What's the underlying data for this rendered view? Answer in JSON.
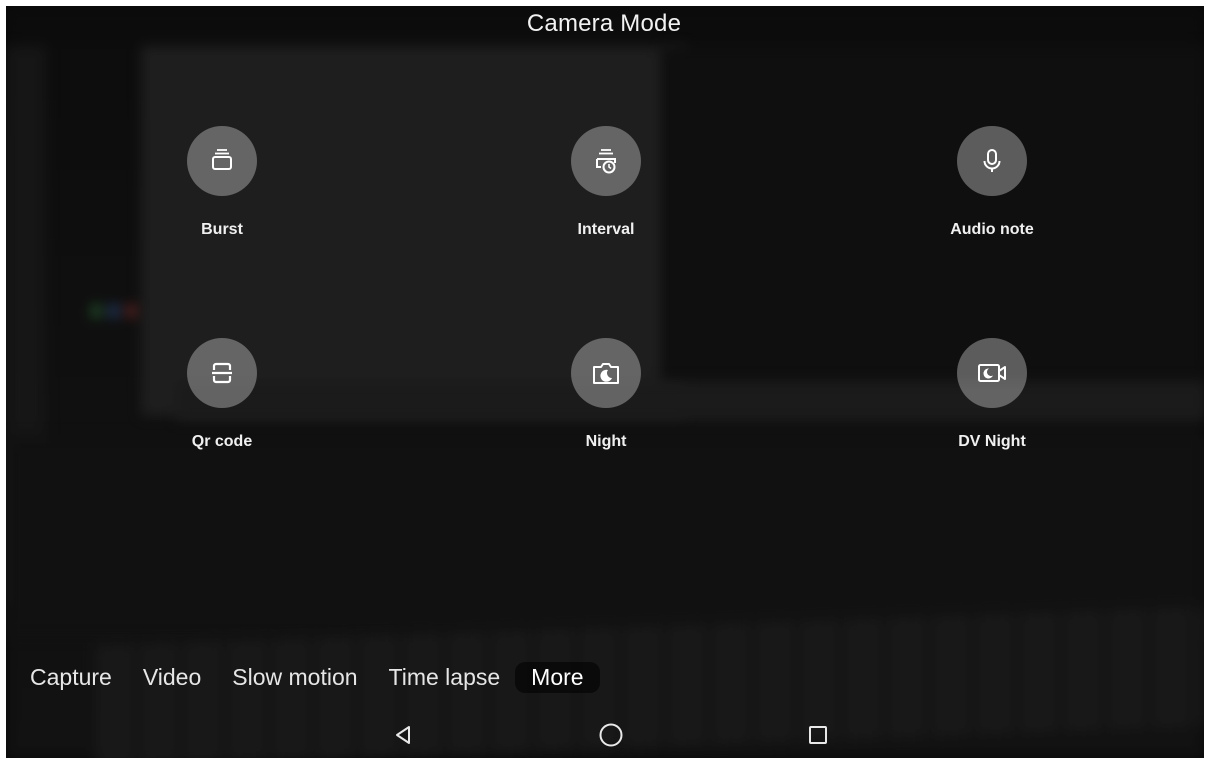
{
  "header": {
    "title": "Camera Mode"
  },
  "modes": [
    {
      "label": "Burst",
      "icon": "burst-icon"
    },
    {
      "label": "Interval",
      "icon": "interval-icon"
    },
    {
      "label": "Audio note",
      "icon": "microphone-icon"
    },
    {
      "label": "Qr code",
      "icon": "qr-code-icon"
    },
    {
      "label": "Night",
      "icon": "night-camera-icon"
    },
    {
      "label": "DV Night",
      "icon": "night-video-icon"
    }
  ],
  "mode_bar": {
    "tabs": [
      "Capture",
      "Video",
      "Slow motion",
      "Time lapse",
      "More"
    ],
    "active": "More"
  },
  "nav_bar": {
    "buttons": [
      "back-icon",
      "home-icon",
      "recents-icon"
    ]
  },
  "colors": {
    "button_fill": "#c8c8c8",
    "text": "#f0f0f0",
    "background": "#0d0d0d"
  }
}
